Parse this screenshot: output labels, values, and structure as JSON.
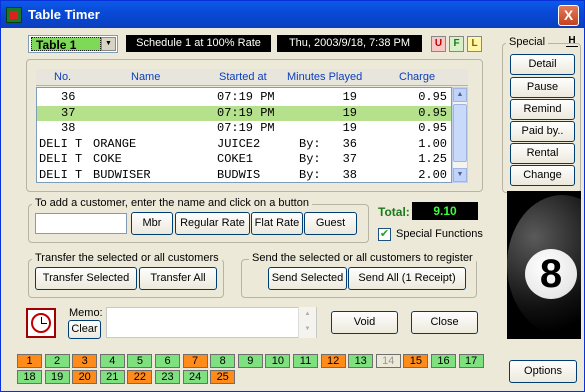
{
  "window": {
    "title": "Table Timer",
    "close_label": "X"
  },
  "header": {
    "table_select": "Table 1",
    "schedule": "Schedule 1 at 100% Rate",
    "datetime": "Thu, 2003/9/18, 7:38 PM",
    "quick_buttons": [
      "U",
      "F",
      "L"
    ]
  },
  "customer_list": {
    "columns": [
      "No.",
      "Name",
      "Started at",
      "Minutes Played",
      "Charge"
    ],
    "rows": [
      {
        "no": "36",
        "name": "",
        "started": "07:19 PM",
        "minutes": "19",
        "charge": "0.95",
        "selected": false
      },
      {
        "no": "37",
        "name": "",
        "started": "07:19 PM",
        "minutes": "19",
        "charge": "0.95",
        "selected": true
      },
      {
        "no": "38",
        "name": "",
        "started": "07:19 PM",
        "minutes": "19",
        "charge": "0.95",
        "selected": false
      },
      {
        "no": "DELI T",
        "name": "ORANGE",
        "started": "JUICE2",
        "by": "By:",
        "minutes": "36",
        "charge": "1.00",
        "selected": false
      },
      {
        "no": "DELI T",
        "name": "COKE",
        "started": "COKE1",
        "by": "By:",
        "minutes": "37",
        "charge": "1.25",
        "selected": false
      },
      {
        "no": "DELI T",
        "name": "BUDWISER",
        "started": "BUDWIS",
        "by": "By:",
        "minutes": "38",
        "charge": "2.00",
        "selected": false
      }
    ]
  },
  "add_customer": {
    "legend": "To add a customer, enter the name and click on a button",
    "name_value": "",
    "buttons": [
      "Mbr",
      "Regular Rate",
      "Flat Rate",
      "Guest"
    ]
  },
  "total": {
    "label": "Total:",
    "value": "9.10"
  },
  "special_functions": {
    "label": "Special Functions",
    "checked": true
  },
  "transfer": {
    "legend": "Transfer the selected or all customers",
    "buttons": [
      "Transfer Selected",
      "Transfer All"
    ]
  },
  "send": {
    "legend": "Send the selected or all customers to register",
    "buttons": [
      "Send  Selected",
      "Send All (1 Receipt)"
    ]
  },
  "memo": {
    "label": "Memo:",
    "clear_label": "Clear",
    "value": ""
  },
  "actions": {
    "void_label": "Void",
    "close_label": "Close"
  },
  "special": {
    "label": "Special",
    "help": "H",
    "buttons": [
      "Detail",
      "Pause",
      "Remind",
      "Paid by..",
      "Rental",
      "Change"
    ],
    "options_label": "Options"
  },
  "tables": [
    {
      "n": "1",
      "color": "#ff8c1a"
    },
    {
      "n": "2",
      "color": "#7fe07f"
    },
    {
      "n": "3",
      "color": "#ff8c1a"
    },
    {
      "n": "4",
      "color": "#7fe07f"
    },
    {
      "n": "5",
      "color": "#7fe07f"
    },
    {
      "n": "6",
      "color": "#7fe07f"
    },
    {
      "n": "7",
      "color": "#ff8c1a"
    },
    {
      "n": "8",
      "color": "#7fe07f"
    },
    {
      "n": "9",
      "color": "#7fe07f"
    },
    {
      "n": "10",
      "color": "#7fe07f"
    },
    {
      "n": "11",
      "color": "#7fe07f"
    },
    {
      "n": "12",
      "color": "#ff8c1a"
    },
    {
      "n": "13",
      "color": "#7fe07f"
    },
    {
      "n": "14",
      "color": "#ece9d8"
    },
    {
      "n": "15",
      "color": "#ff8c1a"
    },
    {
      "n": "16",
      "color": "#7fe07f"
    },
    {
      "n": "17",
      "color": "#7fe07f"
    },
    {
      "n": "18",
      "color": "#7fe07f"
    },
    {
      "n": "19",
      "color": "#7fe07f"
    },
    {
      "n": "20",
      "color": "#ff8c1a"
    },
    {
      "n": "21",
      "color": "#7fe07f"
    },
    {
      "n": "22",
      "color": "#ff8c1a"
    },
    {
      "n": "23",
      "color": "#7fe07f"
    },
    {
      "n": "24",
      "color": "#7fe07f"
    },
    {
      "n": "25",
      "color": "#ff8c1a"
    }
  ],
  "ball_number": "8"
}
